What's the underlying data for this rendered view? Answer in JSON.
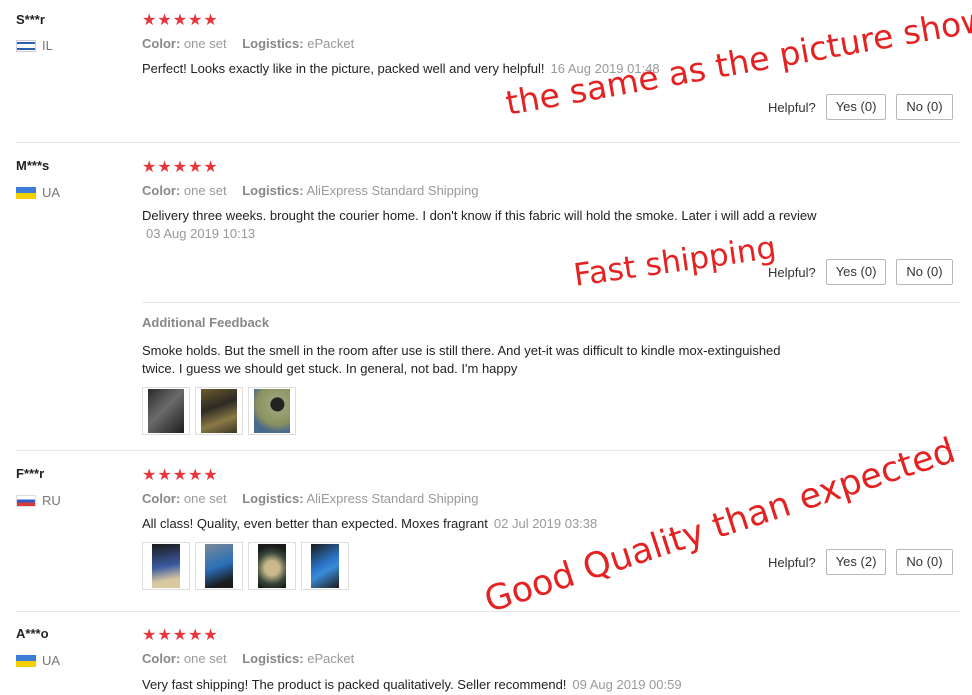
{
  "reviews": [
    {
      "name": "S***r",
      "country": "IL",
      "stars": "★★★★★",
      "color_label": "Color:",
      "color_value": "one set",
      "logistics_label": "Logistics:",
      "logistics_value": "ePacket",
      "text": "Perfect! Looks exactly like in the picture, packed well and very helpful!",
      "date": "16 Aug 2019 01:48",
      "helpful_label": "Helpful?",
      "yes": "Yes (0)",
      "no": "No (0)"
    },
    {
      "name": "M***s",
      "country": "UA",
      "stars": "★★★★★",
      "color_label": "Color:",
      "color_value": "one set",
      "logistics_label": "Logistics:",
      "logistics_value": "AliExpress Standard Shipping",
      "text": "Delivery three weeks. brought the courier home. I don't know if this fabric will hold the smoke. Later i will add a review",
      "date": "03 Aug 2019 10:13",
      "helpful_label": "Helpful?",
      "yes": "Yes (0)",
      "no": "No (0)",
      "additional_title": "Additional Feedback",
      "additional_text_1": "Smoke holds. But the smell in the room after use is still there. And yet-it was difficult to kindle mox-extinguished",
      "additional_text_2": "twice. I guess we should get stuck. In general, not bad. I'm happy"
    },
    {
      "name": "F***r",
      "country": "RU",
      "stars": "★★★★★",
      "color_label": "Color:",
      "color_value": "one set",
      "logistics_label": "Logistics:",
      "logistics_value": "AliExpress Standard Shipping",
      "text": "All class! Quality, even better than expected. Moxes fragrant",
      "date": "02 Jul 2019 03:38",
      "helpful_label": "Helpful?",
      "yes": "Yes (2)",
      "no": "No (0)"
    },
    {
      "name": "A***o",
      "country": "UA",
      "stars": "★★★★★",
      "color_label": "Color:",
      "color_value": "one set",
      "logistics_label": "Logistics:",
      "logistics_value": "ePacket",
      "text": "Very fast shipping! The product is packed qualitatively. Seller recommend!",
      "date": "09 Aug 2019 00:59"
    }
  ],
  "overlays": {
    "same_as_picture": "the same as the picture show",
    "fast_shipping": "Fast shipping",
    "good_quality": "Good Quality than expected"
  },
  "colors": {
    "star": "#e8373c",
    "overlay_text": "#e52222",
    "muted": "#999999"
  }
}
